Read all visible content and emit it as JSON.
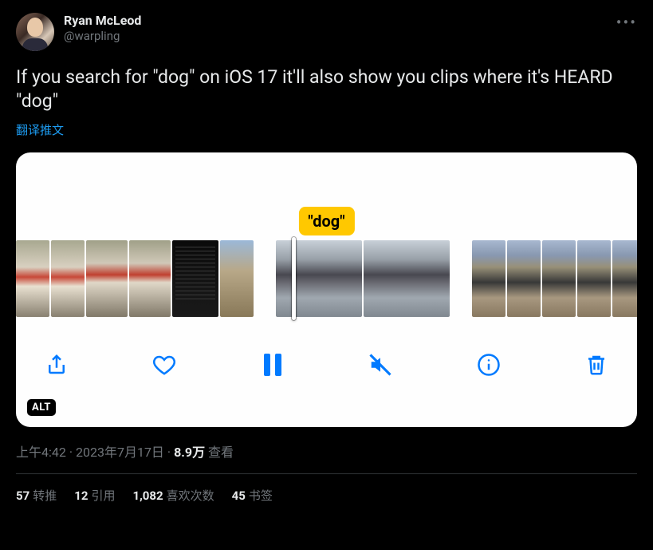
{
  "user": {
    "display_name": "Ryan McLeod",
    "handle": "@warpling"
  },
  "tweet": {
    "text": "If you search for \"dog\" on iOS 17 it'll also show you clips where it's HEARD \"dog\"",
    "translate_label": "翻译推文"
  },
  "media": {
    "search_badge": "\"dog\"",
    "alt_badge": "ALT"
  },
  "meta": {
    "time": "上午4:42",
    "dot1": " · ",
    "date": "2023年7月17日",
    "dot2": " · ",
    "views_number": "8.9万",
    "views_label": " 查看"
  },
  "stats": {
    "retweets_num": "57",
    "retweets_label": "转推",
    "quotes_num": "12",
    "quotes_label": "引用",
    "likes_num": "1,082",
    "likes_label": "喜欢次数",
    "bookmarks_num": "45",
    "bookmarks_label": "书签"
  }
}
